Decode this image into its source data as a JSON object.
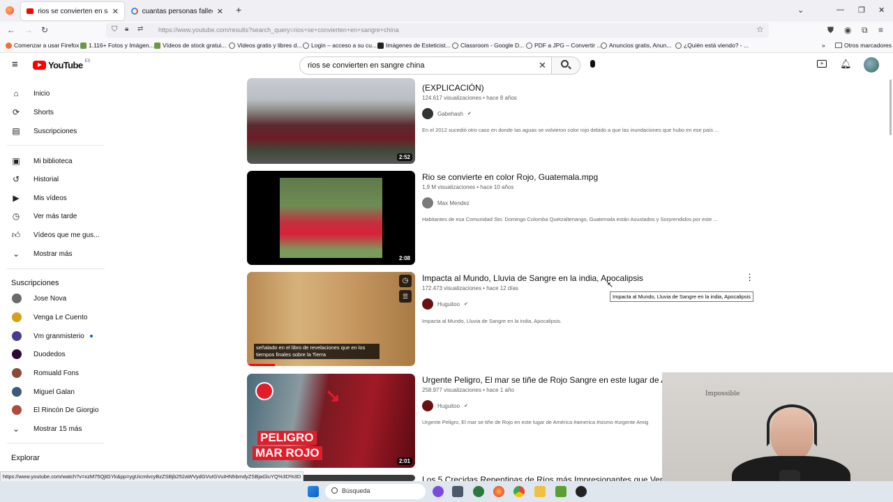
{
  "browser": {
    "tabs": [
      {
        "title": "rios se convierten en sangre ch",
        "close": "✕"
      },
      {
        "title": "cuantas personas fallecieron en",
        "close": "✕"
      }
    ],
    "new_tab": "+",
    "url": "https://www.youtube.com/results?search_query=rios+se+convierten+en+sangre+china",
    "bookmarks": [
      "Comenzar a usar Firefox",
      "1.116+ Fotos y Imágen...",
      "Vídeos de stock gratui...",
      "Videos gratis y libres d...",
      "Login – acceso a su cu...",
      "Imágenes de Esteticist...",
      "Classroom - Google D...",
      "PDF a JPG – Convertir ...",
      "Anuncios gratis, Anun...",
      "¿Quién está viendo? - ..."
    ],
    "other_bookmarks": "Otros marcadores"
  },
  "youtube": {
    "logo": "YouTube",
    "region": "ES",
    "search_query": "rios se convierten en sangre china"
  },
  "sidebar": {
    "main": [
      {
        "label": "Inicio",
        "icon": "home-icon"
      },
      {
        "label": "Shorts",
        "icon": "shorts-icon"
      },
      {
        "label": "Suscripciones",
        "icon": "subscriptions-icon"
      }
    ],
    "library": [
      {
        "label": "Mi biblioteca",
        "icon": "library-icon"
      },
      {
        "label": "Historial",
        "icon": "history-icon"
      },
      {
        "label": "Mis vídeos",
        "icon": "my-videos-icon"
      },
      {
        "label": "Ver más tarde",
        "icon": "watch-later-icon"
      },
      {
        "label": "Vídeos que me gus...",
        "icon": "liked-icon"
      },
      {
        "label": "Mostrar más",
        "icon": "chevron-down-icon"
      }
    ],
    "subscriptions_heading": "Suscripciones",
    "subscriptions": [
      {
        "label": "Jose Nova",
        "color": "#6b6b6b"
      },
      {
        "label": "Venga Le Cuento",
        "color": "#d6a019"
      },
      {
        "label": "Vm granmisterio",
        "color": "#4a3c8c"
      },
      {
        "label": "Duodedos",
        "color": "#2b0a38"
      },
      {
        "label": "Romuald Fons",
        "color": "#8a4a3a"
      },
      {
        "label": "Miguel Galan",
        "color": "#3e5a7a"
      },
      {
        "label": "El Rincón De Giorgio",
        "color": "#b04a3a"
      }
    ],
    "show_more_subs": "Mostrar 15 más",
    "explore_heading": "Explorar"
  },
  "results": [
    {
      "title": "(EXPLICACIÓN)",
      "views": "124.617 visualizaciones",
      "age": "hace 8 años",
      "channel": "Gabehash",
      "verified": true,
      "description": "En el 2012 sucedió otro caso en donde las aguas se volvieron color rojo debido a que las inundaciones que hubo en ese país ...",
      "duration": "2:52"
    },
    {
      "title": "Rio se convierte en color Rojo, Guatemala.mpg",
      "views": "1,9 M visualizaciones",
      "age": "hace 10 años",
      "channel": "Max Mendez",
      "verified": false,
      "description": "Habitantes de esa Comunidad Sto. Domingo Colomba Quetzaltenango, Guatemala están Asustados y Sorprendidos por este ...",
      "duration": "2:08"
    },
    {
      "title": "Impacta al Mundo, Lluvia de Sangre en la india, Apocalipsis",
      "views": "172.473 visualizaciones",
      "age": "hace 12 días",
      "channel": "Huguitoo",
      "verified": true,
      "description": "Impacta al Mundo, Lluvia de Sangre en la india, Apocalipsis.",
      "caption": "señalado en el libro de revelaciones que en los tiempos finales sobre la Tierra"
    },
    {
      "title": "Urgente Peligro, El mar se tiñe de Rojo Sangre en este lugar de Am",
      "views": "258.977 visualizaciones",
      "age": "hace 1 año",
      "channel": "Huguitoo",
      "verified": true,
      "description": "Urgente Peligro, El mar se tiñe de Rojo en este lugar de América #america #sismo #urgente Amig",
      "duration": "2:01",
      "overlay_line1": "PELIGRO",
      "overlay_line2": "MAR ROJO"
    }
  ],
  "partial_title": "Los 5 Crecidas Repentinas de Ríos más Impresionantes que Verá",
  "tooltip": "Impacta al Mundo, Lluvia de Sangre en la india, Apocalipsis",
  "status_url": "https://www.youtube.com/watch?v=xzM75QjtGYk&pp=ygUicmlvcyBzZSBjb252aWVydGVuIGVuIHNhbmdyZSBjaGluYQ%3D%3D",
  "taskbar": {
    "search": "Búsqueda"
  },
  "webcam": {
    "wall_text": "Impossible"
  },
  "colors": {
    "youtube_red": "#ff0000",
    "accent_blue": "#065fd4"
  }
}
